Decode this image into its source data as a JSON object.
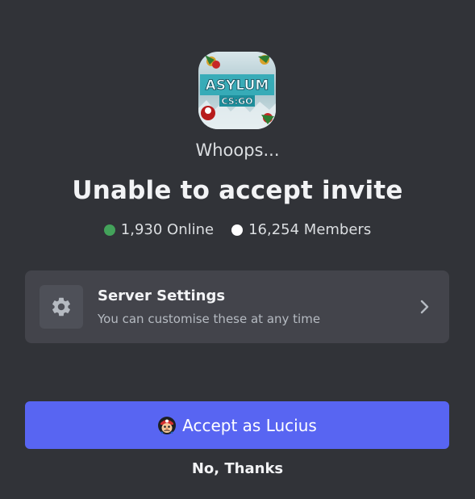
{
  "server": {
    "icon_name": "server-icon",
    "icon_text_top": "ASYLUM",
    "icon_text_bottom": "CS:GO"
  },
  "invite": {
    "subtitle": "Whoops...",
    "title": "Unable to accept invite",
    "online_count": "1,930 Online",
    "member_count": "16,254 Members",
    "online_color": "#43a25a",
    "members_color": "#ffffff"
  },
  "settings_card": {
    "title": "Server Settings",
    "subtitle": "You can customise these at any time",
    "icon": "gear-icon",
    "chevron": "chevron-right-icon"
  },
  "actions": {
    "accept_label": "Accept as Lucius",
    "decline_label": "No, Thanks",
    "accent_color": "#5865f2"
  }
}
